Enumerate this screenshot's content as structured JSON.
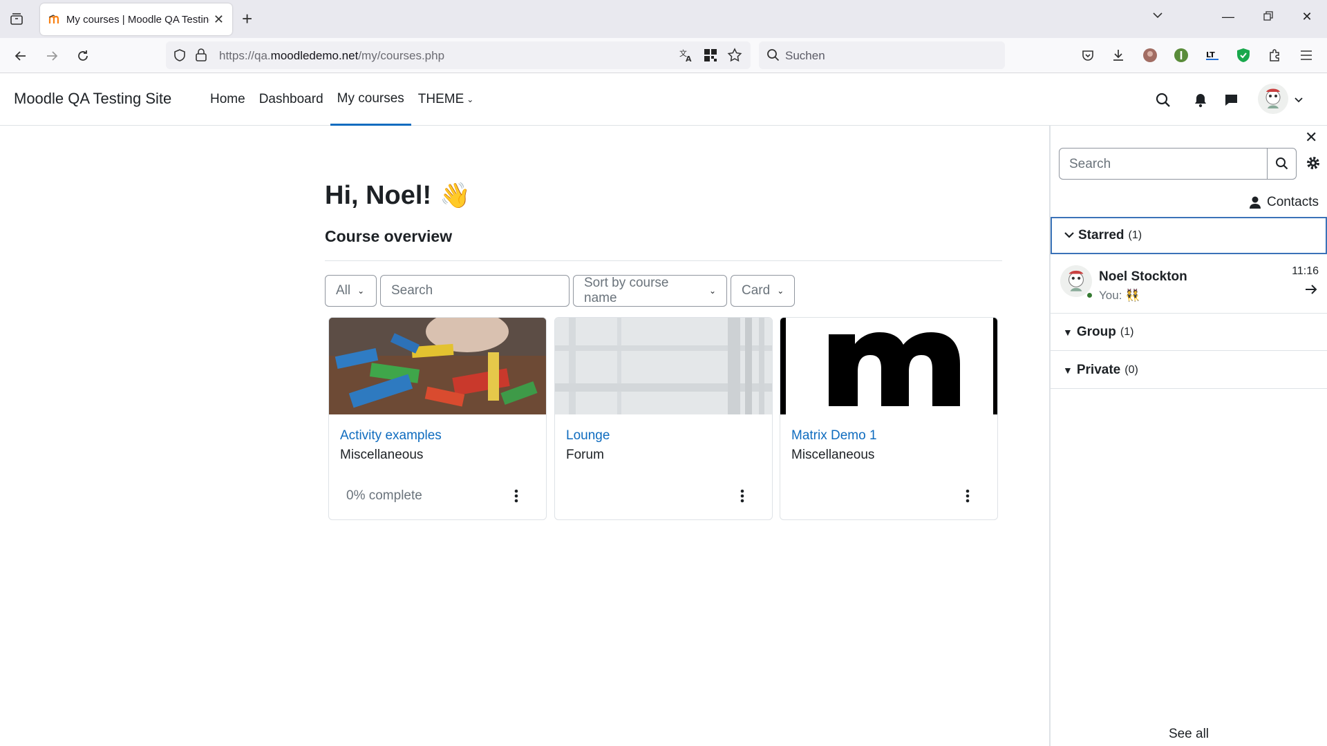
{
  "browser": {
    "tab_title": "My courses | Moodle QA Testing",
    "url_prefix": "https://qa.",
    "url_domain": "moodledemo.net",
    "url_path": "/my/courses.php",
    "search_placeholder": "Suchen"
  },
  "header": {
    "site_name": "Moodle QA Testing Site",
    "nav": [
      {
        "label": "Home"
      },
      {
        "label": "Dashboard"
      },
      {
        "label": "My courses"
      },
      {
        "label": "THEME"
      }
    ]
  },
  "main": {
    "greeting": "Hi, Noel!",
    "greeting_emoji": "👋",
    "section_title": "Course overview",
    "filters": {
      "grouping": "All",
      "search_placeholder": "Search",
      "sort": "Sort by course name",
      "view": "Card"
    },
    "courses": [
      {
        "name": "Activity examples",
        "category": "Miscellaneous",
        "progress": "0% complete"
      },
      {
        "name": "Lounge",
        "category": "Forum",
        "progress": ""
      },
      {
        "name": "Matrix Demo 1",
        "category": "Miscellaneous",
        "progress": ""
      }
    ]
  },
  "drawer": {
    "search_placeholder": "Search",
    "contacts_label": "Contacts",
    "sections": {
      "starred": {
        "label": "Starred",
        "count": "(1)"
      },
      "group": {
        "label": "Group",
        "count": "(1)"
      },
      "private": {
        "label": "Private",
        "count": "(0)"
      }
    },
    "conversation": {
      "name": "Noel Stockton",
      "message": "You: 👯",
      "time": "11:16"
    },
    "see_all": "See all"
  },
  "colors": {
    "accent": "#0f6cbf",
    "online": "#357a32"
  }
}
